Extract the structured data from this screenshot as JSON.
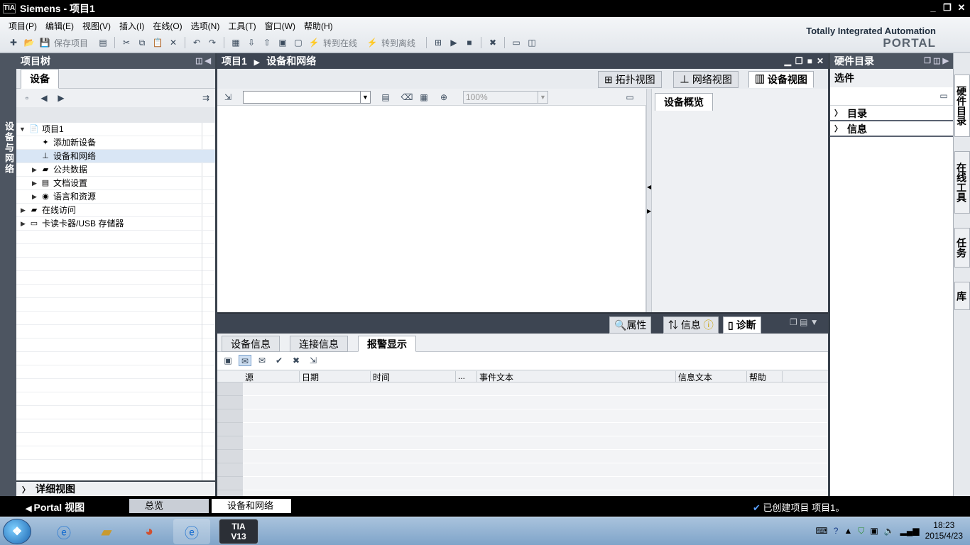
{
  "window": {
    "title": "Siemens  -  项目1",
    "logo": "TIA"
  },
  "menu": [
    "项目(P)",
    "编辑(E)",
    "视图(V)",
    "插入(I)",
    "在线(O)",
    "选项(N)",
    "工具(T)",
    "窗口(W)",
    "帮助(H)"
  ],
  "toolbar": {
    "save_label": "保存项目",
    "go_online": "转到在线",
    "go_offline": "转到离线"
  },
  "brand": {
    "line1": "Totally Integrated Automation",
    "line2": "PORTAL"
  },
  "left_strip_label": "设备与网络",
  "project_tree": {
    "title": "项目树",
    "tab": "设备",
    "items": [
      {
        "label": "项目1",
        "level": 0,
        "expanded": true,
        "icon": "project-icon"
      },
      {
        "label": "添加新设备",
        "level": 1,
        "icon": "add-device-icon"
      },
      {
        "label": "设备和网络",
        "level": 1,
        "icon": "network-icon"
      },
      {
        "label": "公共数据",
        "level": 1,
        "collapsed": true,
        "icon": "folder-icon"
      },
      {
        "label": "文档设置",
        "level": 1,
        "collapsed": true,
        "icon": "document-icon"
      },
      {
        "label": "语言和资源",
        "level": 1,
        "collapsed": true,
        "icon": "language-icon"
      },
      {
        "label": "在线访问",
        "level": 0,
        "collapsed": true,
        "icon": "online-access-icon"
      },
      {
        "label": "卡读卡器/USB 存储器",
        "level": 0,
        "collapsed": true,
        "icon": "card-reader-icon"
      }
    ],
    "detail_view": "详细视图"
  },
  "editor": {
    "breadcrumb": [
      "项目1",
      "设备和网络"
    ],
    "view_tabs": [
      "拓扑视图",
      "网络视图",
      "设备视图"
    ],
    "selected_view": "设备视图",
    "zoom": "100%",
    "overview_tab": "设备概览"
  },
  "inspector": {
    "tabs": [
      "属性",
      "信息",
      "诊断"
    ],
    "selected_tab": "诊断",
    "sub_tabs": [
      "设备信息",
      "连接信息",
      "报警显示"
    ],
    "selected_sub_tab": "报警显示",
    "columns": [
      "源",
      "日期",
      "时间",
      "...",
      "事件文本",
      "信息文本",
      "帮助"
    ]
  },
  "hardware_catalog": {
    "title": "硬件目录",
    "options": "选件",
    "sections": [
      "目录",
      "信息"
    ]
  },
  "right_tabs": [
    "硬件目录",
    "在线工具",
    "任务",
    "库"
  ],
  "statusbar": {
    "portal_view": "Portal 视图",
    "tabs": [
      "总览",
      "设备和网络"
    ],
    "message": "已创建项目 项目1。"
  },
  "taskbar": {
    "tia_line1": "TIA",
    "tia_line2": "V13",
    "time": "18:23",
    "date": "2015/4/23"
  }
}
